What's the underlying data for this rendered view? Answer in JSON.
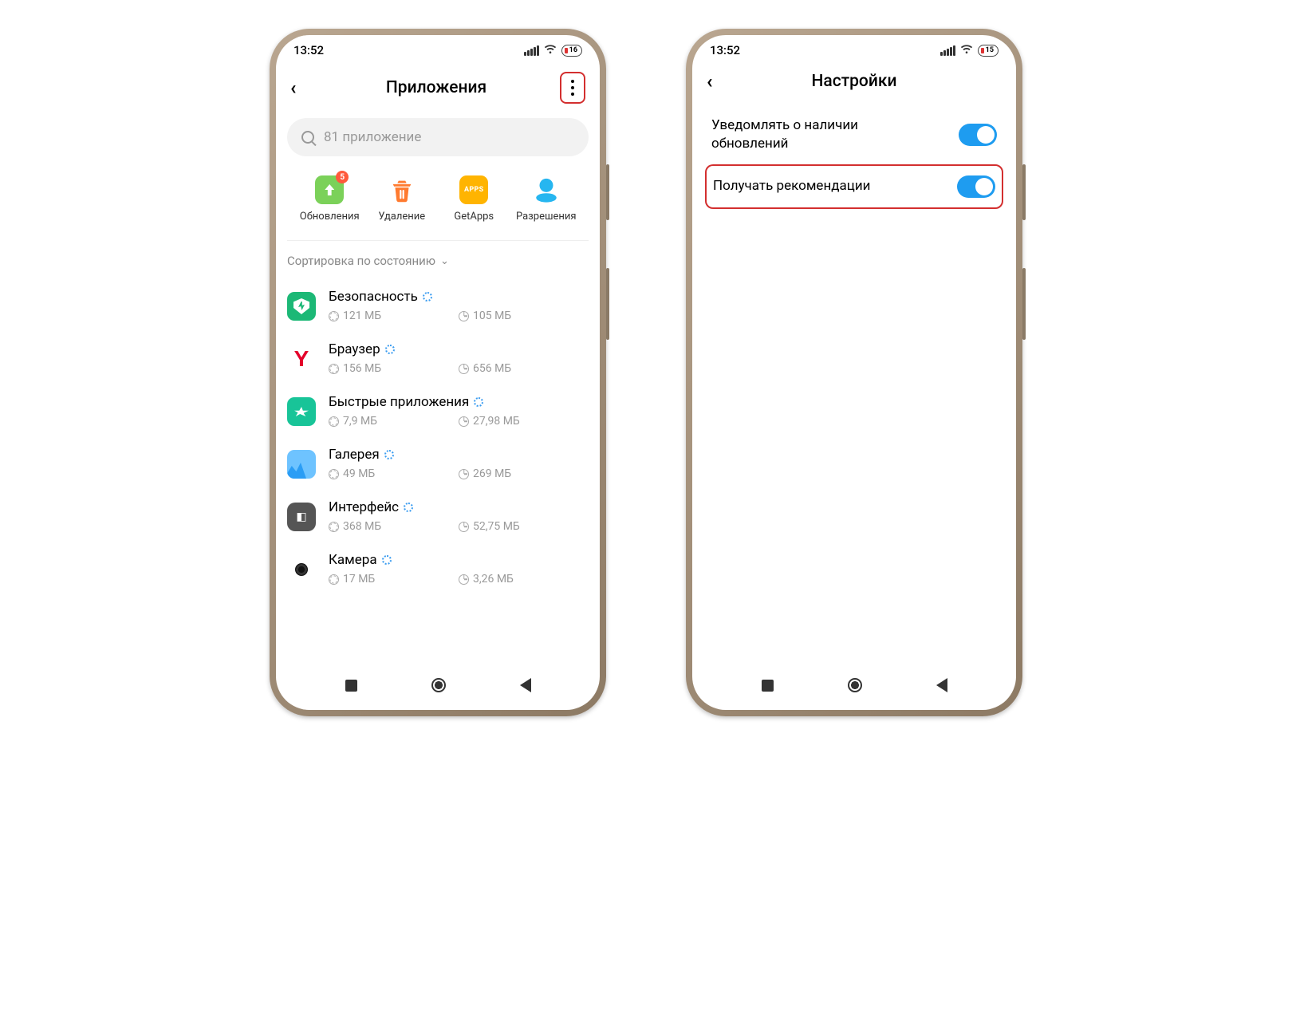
{
  "phone1": {
    "status": {
      "time": "13:52",
      "battery": "16"
    },
    "header": {
      "title": "Приложения"
    },
    "search": {
      "placeholder": "81 приложение"
    },
    "quick": {
      "updates": {
        "label": "Обновления",
        "badge": "5"
      },
      "uninstall": {
        "label": "Удаление"
      },
      "getapps": {
        "label": "GetApps",
        "icon_text": "APPS"
      },
      "permissions": {
        "label": "Разрешения"
      }
    },
    "sort_label": "Сортировка по состоянию",
    "apps": [
      {
        "name": "Безопасность",
        "storage": "121 МБ",
        "time": "105 МБ"
      },
      {
        "name": "Браузер",
        "storage": "156 МБ",
        "time": "656 МБ"
      },
      {
        "name": "Быстрые приложения",
        "storage": "7,9 МБ",
        "time": "27,98 МБ"
      },
      {
        "name": "Галерея",
        "storage": "49 МБ",
        "time": "269 МБ"
      },
      {
        "name": "Интерфейс",
        "storage": "368 МБ",
        "time": "52,75 МБ"
      },
      {
        "name": "Камера",
        "storage": "17 МБ",
        "time": "3,26 МБ"
      }
    ]
  },
  "phone2": {
    "status": {
      "time": "13:52",
      "battery": "15"
    },
    "header": {
      "title": "Настройки"
    },
    "settings": [
      {
        "label": "Уведомлять о наличии обновлений",
        "on": true
      },
      {
        "label": "Получать рекомендации",
        "on": true
      }
    ]
  }
}
